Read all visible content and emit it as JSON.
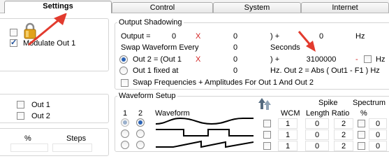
{
  "tabs": [
    "Settings",
    "Control",
    "System",
    "Internet"
  ],
  "colors": {
    "annotation_arrow": "#e23b2e",
    "accent_red": "#d11f1f",
    "lock": "#e1a21b"
  },
  "left_panel": {
    "modulate_label": "Modulate Out 1",
    "modulate_checked": true,
    "unnamed_checkbox_checked": false,
    "out1_label": "Out 1",
    "out2_label": "Out 2",
    "percent_header": "%",
    "steps_header": "Steps"
  },
  "output_shadowing": {
    "legend": "Output Shadowing",
    "output_label": "Output =",
    "output_value": "0",
    "output_x": "X",
    "output_mult": "0",
    "output_plus": ") +",
    "output_add": "0",
    "output_unit": "Hz",
    "swap_label": "Swap Waveform Every",
    "swap_value": "0",
    "swap_unit": "Seconds",
    "out2_label": "Out 2 = (Out 1",
    "out2_x": "X",
    "out2_mult": "0",
    "out2_plus": ") +",
    "out2_add": "3100000",
    "out2_minus": "-",
    "out2_hz": "Hz",
    "out1fixed_label": "Out 1 fixed at",
    "out1fixed_value": "0",
    "out1fixed_formula": "Hz. Out 2 = Abs ( Out1 - F1 ) Hz",
    "swap_freq_label": "Swap Frequencies + Amplitudes For Out 1 And Out 2",
    "swap_freq_checked": false
  },
  "waveform_setup": {
    "legend": "Waveform Setup",
    "col_1": "1",
    "col_2": "2",
    "col_waveform": "Waveform",
    "col_spike": "Spike",
    "col_spectrum": "Spectrum",
    "col_wcm": "WCM",
    "col_length_ratio": "Length Ratio",
    "col_percent": "%",
    "rows": [
      {
        "out1": true,
        "out2": true,
        "wave": "sine",
        "enabled": false,
        "wcm": "1",
        "length": "0",
        "ratio": "2",
        "spec_checked": false,
        "spectrum": "0"
      },
      {
        "out1": false,
        "out2": false,
        "wave": "square",
        "enabled": false,
        "wcm": "1",
        "length": "0",
        "ratio": "2",
        "spec_checked": false,
        "spectrum": "0"
      },
      {
        "out1": false,
        "out2": false,
        "wave": "sawtooth",
        "enabled": false,
        "wcm": "1",
        "length": "0",
        "ratio": "2",
        "spec_checked": false,
        "spectrum": "0"
      }
    ]
  }
}
